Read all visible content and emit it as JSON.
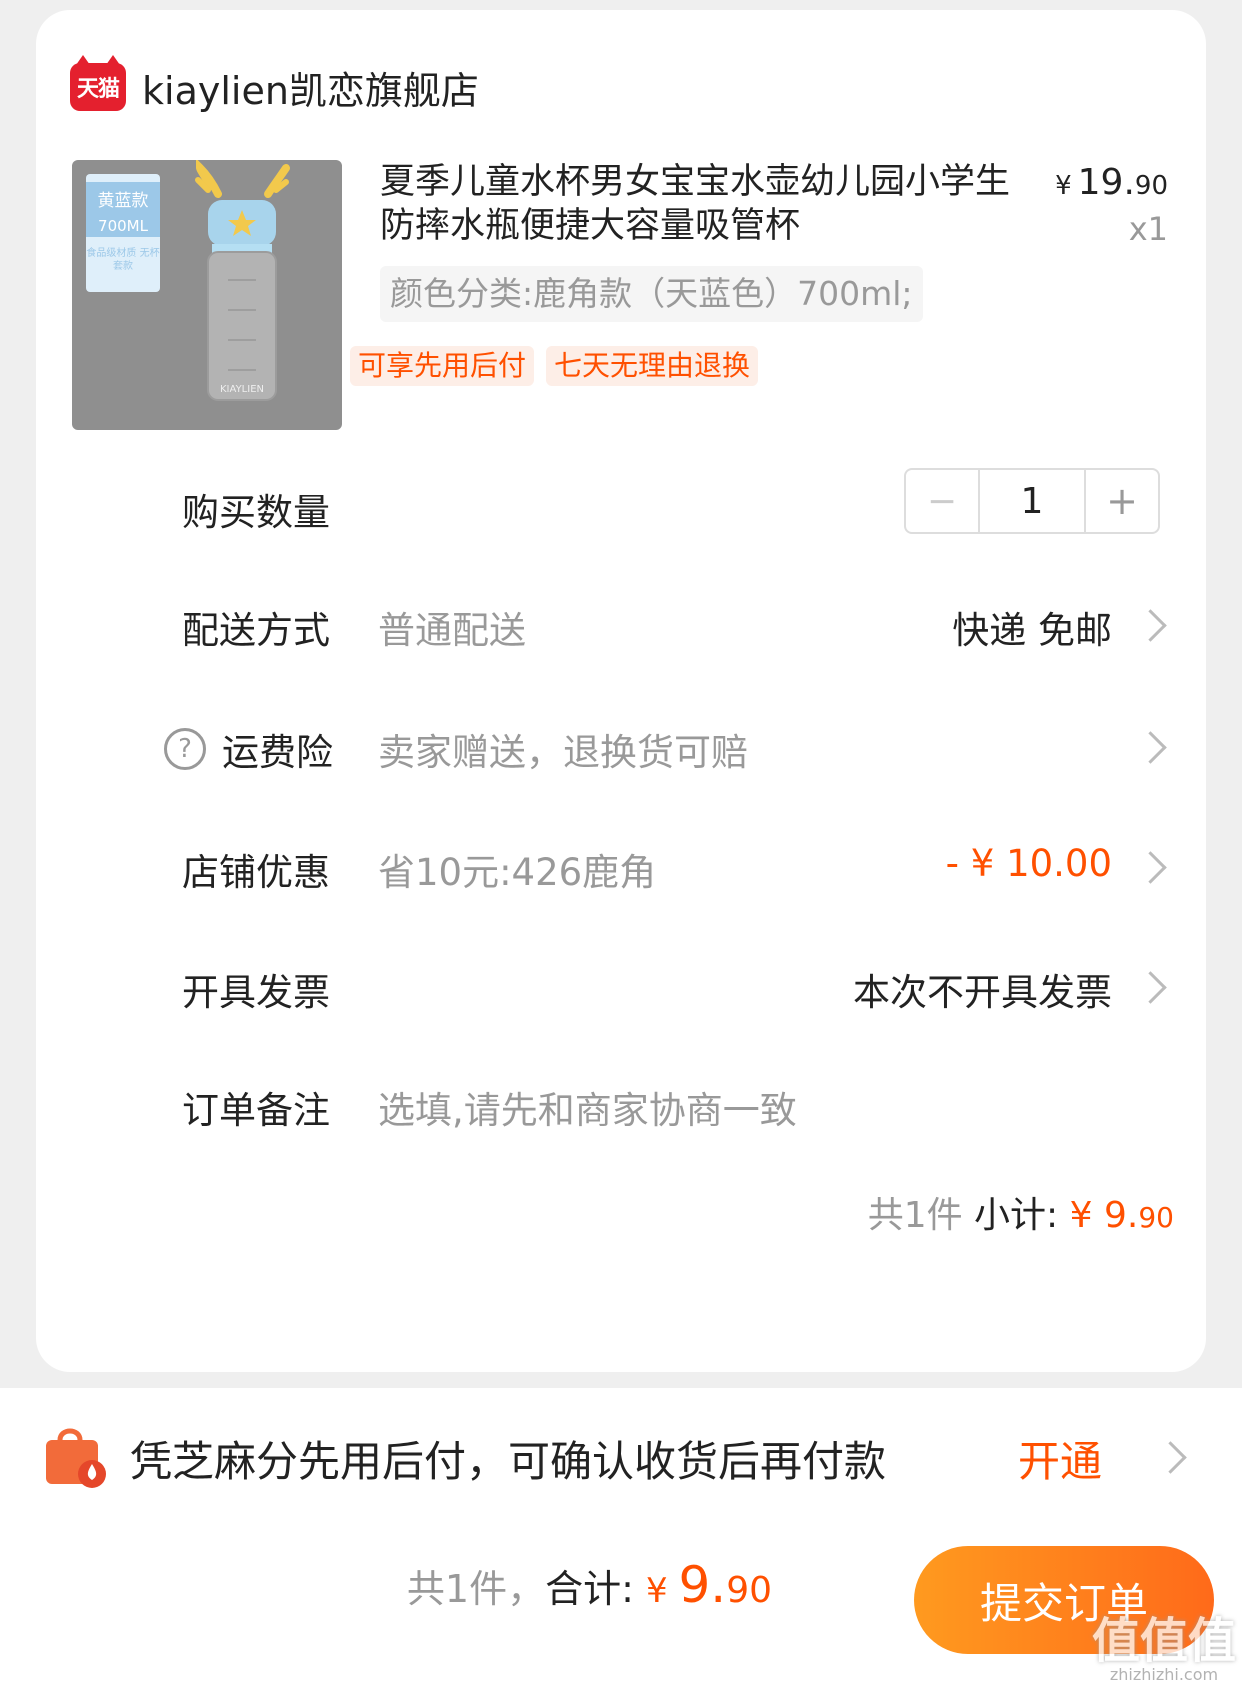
{
  "store": {
    "name": "kiaylien凯恋旗舰店",
    "logo_text": "天猫"
  },
  "product": {
    "image_tag_line1": "黄蓝款",
    "image_tag_line2": "700ML",
    "image_tag_line3": "食品级材质 无杯套款",
    "image_brand": "KIAYLIEN",
    "title": "夏季儿童水杯男女宝宝水壶幼儿园小学生防摔水瓶便捷大容量吸管杯",
    "price_yen": "¥",
    "price_int": "19.",
    "price_dec": "90",
    "quantity_label": "x1",
    "sku": "颜色分类:鹿角款（天蓝色）700ml;",
    "perks": [
      "可享先用后付",
      "七天无理由退换"
    ]
  },
  "rows": {
    "quantity": {
      "label": "购买数量",
      "value": "1",
      "minus": "−",
      "plus": "+"
    },
    "delivery": {
      "label": "配送方式",
      "sub": "普通配送",
      "value": "快递 免邮"
    },
    "insurance": {
      "label": "运费险",
      "sub": "卖家赠送，退换货可赔",
      "help": "?"
    },
    "discount": {
      "label": "店铺优惠",
      "sub": "省10元:426鹿角",
      "value": "- ¥ 10.00"
    },
    "invoice": {
      "label": "开具发票",
      "value": "本次不开具发票"
    },
    "note": {
      "label": "订单备注",
      "placeholder": "选填,请先和商家协商一致"
    }
  },
  "subtotal": {
    "count": "共1件",
    "label": "小计:",
    "yen": "¥ ",
    "int": "9.",
    "dec": "90"
  },
  "pay_later": {
    "text": "凭芝麻分先用后付，可确认收货后再付款",
    "action": "开通"
  },
  "footer": {
    "count": "共1件，",
    "label": "合计:",
    "yen": "¥ ",
    "int": "9.",
    "dec": "90",
    "submit": "提交订单"
  },
  "watermark": {
    "line1": "值值值",
    "line2": "zhizhizhi.com"
  },
  "colors": {
    "accent": "#ff5000",
    "submit_start": "#ff9a1f",
    "submit_end": "#ff6a1a"
  }
}
